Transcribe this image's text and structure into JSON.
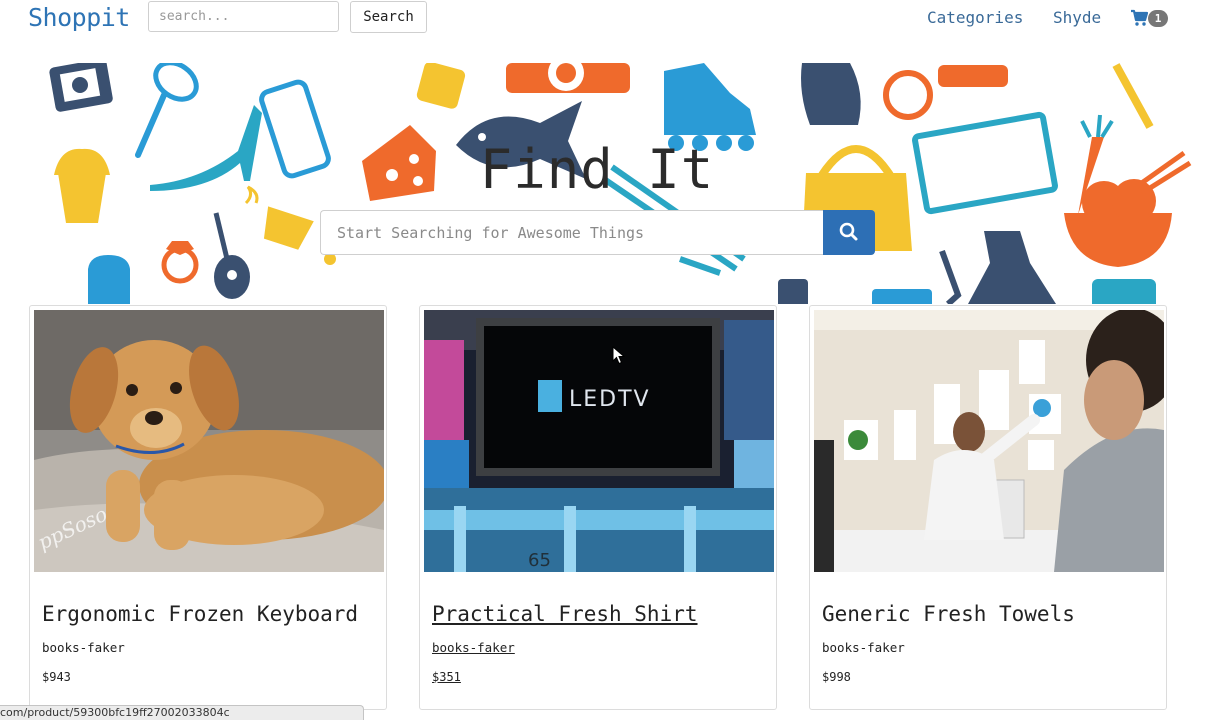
{
  "navbar": {
    "brand": "Shoppit",
    "search_placeholder": "search...",
    "search_button": "Search",
    "links": [
      "Categories",
      "Shyde"
    ],
    "cart_count": "1"
  },
  "hero": {
    "title": "Find It",
    "search_placeholder": "Start Searching for Awesome Things"
  },
  "products": [
    {
      "title": "Ergonomic Frozen Keyboard",
      "category": "books-faker",
      "price": "$943",
      "image": "puppy-photo"
    },
    {
      "title": "Practical Fresh Shirt",
      "category": "books-faker",
      "price": "$351",
      "image": "led-tv-photo",
      "tv_logo": "LEDTV",
      "tv_number": "65"
    },
    {
      "title": "Generic Fresh Towels",
      "category": "books-faker",
      "price": "$998",
      "image": "office-presentation-photo"
    }
  ],
  "status_bar": {
    "url": "com/product/59300bfc19ff27002033804c"
  },
  "colors": {
    "brand": "#2e74b5",
    "primary_button": "#2d6fb5",
    "nav_link": "#3a6a98",
    "badge": "#777777"
  }
}
